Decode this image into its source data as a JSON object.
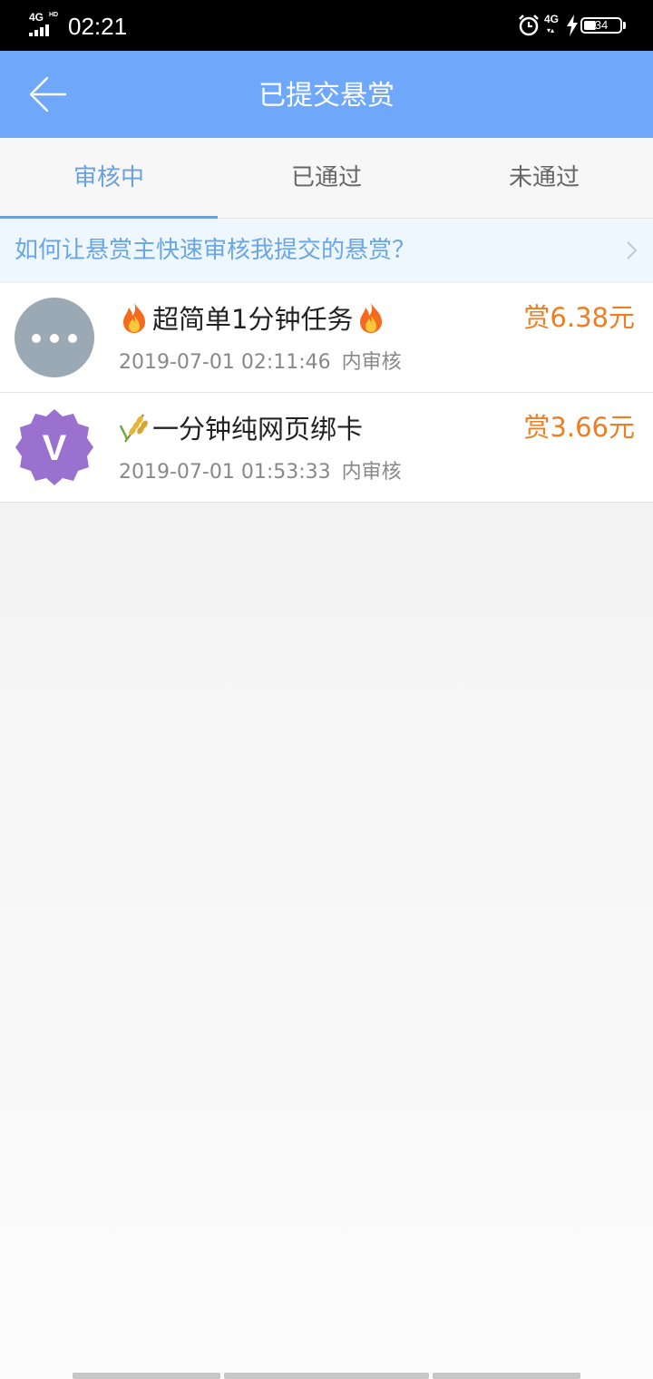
{
  "status_bar": {
    "network": "4G",
    "network_sub": "HD",
    "time": "02:21",
    "network_right": "4G",
    "battery": "34"
  },
  "header": {
    "title": "已提交悬赏",
    "back_icon": "arrow-left-icon"
  },
  "tabs": [
    {
      "label": "审核中",
      "active": true
    },
    {
      "label": "已通过",
      "active": false
    },
    {
      "label": "未通过",
      "active": false
    }
  ],
  "notice": {
    "text": "如何让悬赏主快速审核我提交的悬赏？",
    "icon": "chevron-right-icon"
  },
  "tasks": [
    {
      "title": "超简单1分钟任务",
      "price": "赏6.38元",
      "time": "2019-07-01 02:11:46",
      "status": "内审核",
      "avatar": "more-dots-avatar",
      "emoji": "fire-icon"
    },
    {
      "title": "一分钟纯网页绑卡",
      "price": "赏3.66元",
      "time": "2019-07-01 01:53:33",
      "status": "内审核",
      "avatar": "V",
      "emoji": "rice-icon"
    }
  ],
  "colors": {
    "header_bg": "#6fa8fb",
    "tab_active": "#6a9fe0",
    "notice_text": "#6aa6e6",
    "price": "#ef7d22",
    "avatar_v": "#9a71cf"
  }
}
